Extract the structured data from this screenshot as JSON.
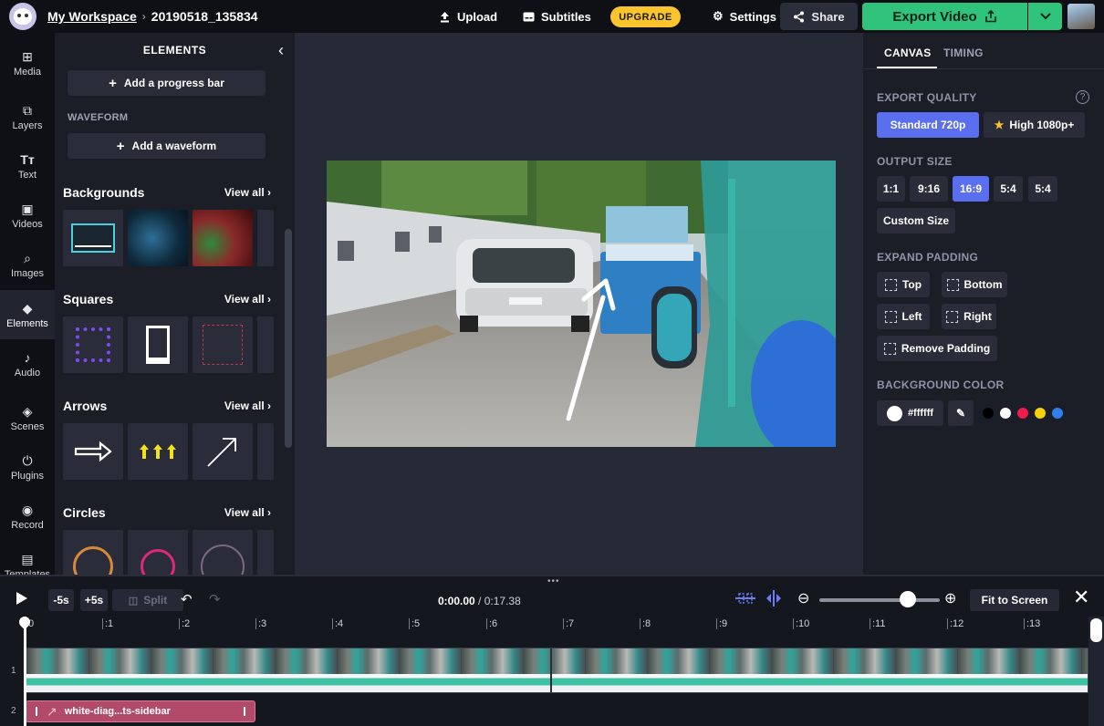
{
  "topbar": {
    "workspace": "My Workspace",
    "project": "20190518_135834",
    "upload": "Upload",
    "subtitles": "Subtitles",
    "upgrade": "UPGRADE",
    "settings": "Settings",
    "share": "Share",
    "export": "Export Video"
  },
  "rail": {
    "items": [
      {
        "label": "Media",
        "icon": "media-icon"
      },
      {
        "label": "Layers",
        "icon": "layers-icon"
      },
      {
        "label": "Text",
        "icon": "text-icon"
      },
      {
        "label": "Videos",
        "icon": "videos-icon"
      },
      {
        "label": "Images",
        "icon": "images-icon"
      },
      {
        "label": "Elements",
        "icon": "elements-icon"
      },
      {
        "label": "Audio",
        "icon": "audio-icon"
      },
      {
        "label": "Scenes",
        "icon": "scenes-icon"
      },
      {
        "label": "Plugins",
        "icon": "plugins-icon"
      },
      {
        "label": "Record",
        "icon": "record-icon"
      },
      {
        "label": "Templates",
        "icon": "templates-icon"
      }
    ],
    "active": "Elements"
  },
  "panel": {
    "title": "ELEMENTS",
    "add_progress_bar": "Add a progress bar",
    "waveform_label": "WAVEFORM",
    "add_waveform": "Add a waveform",
    "sections": [
      {
        "title": "Backgrounds",
        "view_all": "View all"
      },
      {
        "title": "Squares",
        "view_all": "View all"
      },
      {
        "title": "Arrows",
        "view_all": "View all"
      },
      {
        "title": "Circles",
        "view_all": "View all"
      }
    ]
  },
  "rpanel": {
    "tabs": [
      "CANVAS",
      "TIMING"
    ],
    "export_quality_label": "EXPORT QUALITY",
    "quality": [
      "Standard 720p",
      "High 1080p+"
    ],
    "output_size_label": "OUTPUT SIZE",
    "sizes": [
      "1:1",
      "9:16",
      "16:9",
      "5:4",
      "5:4"
    ],
    "selected_size": "16:9",
    "custom_size": "Custom Size",
    "expand_padding_label": "EXPAND PADDING",
    "padding": [
      "Top",
      "Bottom",
      "Left",
      "Right"
    ],
    "remove_padding": "Remove Padding",
    "background_color_label": "BACKGROUND COLOR",
    "bg_value": "#ffffff",
    "swatches": [
      "#000000",
      "#ffffff",
      "#ee1c4a",
      "#f5d20d",
      "#2f80ed"
    ]
  },
  "timeline": {
    "minus5": "-5s",
    "plus5": "+5s",
    "split": "Split",
    "current": "0:00.00",
    "total": "/ 0:17.38",
    "fit": "Fit to Screen",
    "ticks": [
      "0",
      ":1",
      ":2",
      ":3",
      ":4",
      ":5",
      ":6",
      ":7",
      ":8",
      ":9",
      ":10",
      ":11",
      ":12",
      ":13"
    ],
    "track_numbers": [
      "1",
      "2"
    ],
    "clip2_name": "white-diag...ts-sidebar"
  }
}
